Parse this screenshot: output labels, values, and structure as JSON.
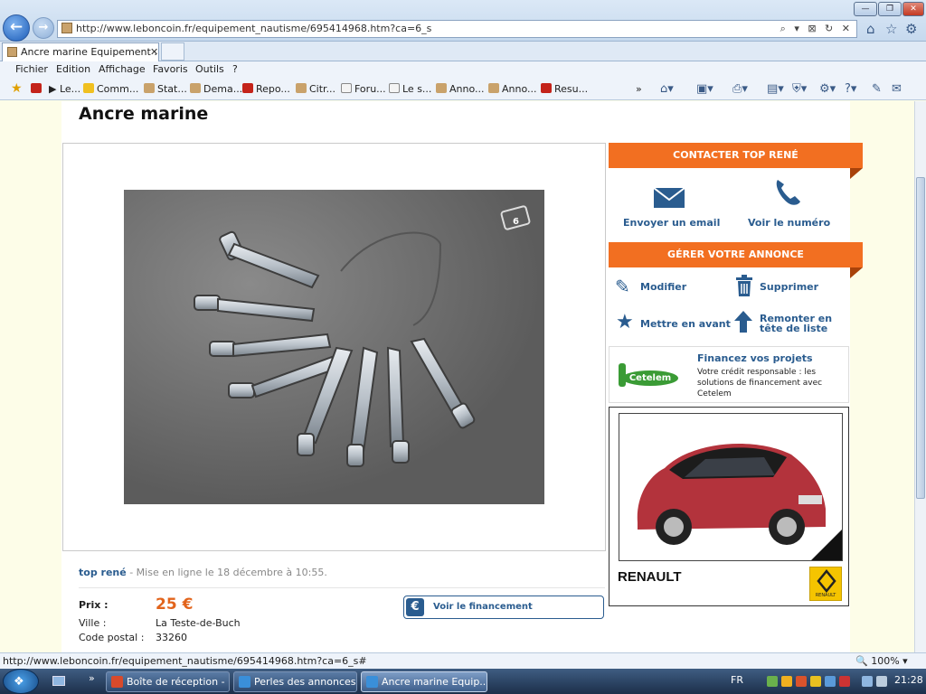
{
  "browser": {
    "url": "http://www.leboncoin.fr/equipement_nautisme/695414968.htm?ca=6_s",
    "tab_title": "Ancre marine Equipement ...",
    "tab_close": "✕",
    "status_url": "http://www.leboncoin.fr/equipement_nautisme/695414968.htm?ca=6_s#",
    "zoom": "100%",
    "menu": [
      "Fichier",
      "Edition",
      "Affichage",
      "Favoris",
      "Outils",
      "?"
    ],
    "favorites": [
      "Le...",
      "Comm...",
      "Stat...",
      "Dema...",
      "Repo...",
      "Citr...",
      "Foru...",
      "Le s...",
      "Anno...",
      "Anno...",
      "Resu..."
    ],
    "address_tools": "⌕ ▾ ⊠ ↻ ✕"
  },
  "listing": {
    "title": "Ancre marine",
    "seller": "top rené",
    "posted": " - Mise en ligne le 18 décembre à 10:55.",
    "price_label": "Prix :",
    "price": "25 €",
    "city_label": "Ville :",
    "city": "La Teste-de-Buch",
    "zip_label": "Code postal :",
    "zip": "33260",
    "financing_button": "Voir le financement",
    "euro_symbol": "€",
    "photo_count": "6"
  },
  "sidebar": {
    "contact_head": "CONTACTER TOP RENÉ",
    "email": "Envoyer un email",
    "phone": "Voir le numéro",
    "manage_head": "GÉRER VOTRE ANNONCE",
    "edit": "Modifier",
    "delete": "Supprimer",
    "feature": "Mettre en avant",
    "bump_1": "Remonter en",
    "bump_2": "tête de liste",
    "cetelem_logo": "Cetelem",
    "cetelem_title": "Financez vos projets",
    "cetelem_text": "Votre crédit responsable : les solutions de financement avec Cetelem",
    "ad_brand": "RENAULT",
    "ad_logo_text": "RENAULT"
  },
  "taskbar": {
    "tasks": [
      "Boîte de réception - ...",
      "Perles des annonces...",
      "Ancre marine Equip..."
    ],
    "language": "FR",
    "clock": "21:28"
  },
  "colors": {
    "accent_orange": "#f26f21",
    "link_blue": "#2a5c8f",
    "price_orange": "#e2641c"
  }
}
